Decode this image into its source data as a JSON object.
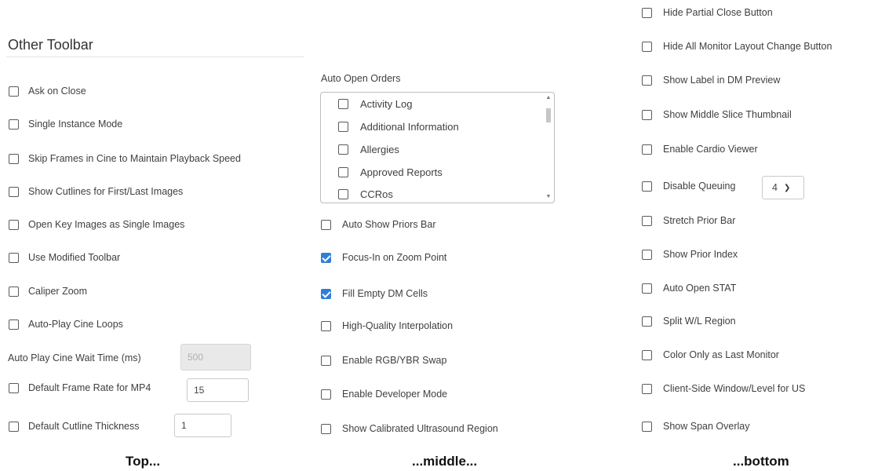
{
  "left": {
    "title": "Other Toolbar",
    "checkboxes": [
      {
        "label": "Ask on Close",
        "checked": false
      },
      {
        "label": "Single Instance Mode",
        "checked": false
      },
      {
        "label": "Skip Frames in Cine to Maintain Playback Speed",
        "checked": false
      },
      {
        "label": "Show Cutlines for First/Last Images",
        "checked": false
      },
      {
        "label": "Open Key Images as Single Images",
        "checked": false
      },
      {
        "label": "Use Modified Toolbar",
        "checked": false
      },
      {
        "label": "Caliper Zoom",
        "checked": false
      },
      {
        "label": "Auto-Play Cine Loops",
        "checked": false
      }
    ],
    "wait_time": {
      "label": "Auto Play Cine Wait Time (ms)",
      "value": "500"
    },
    "frame_rate": {
      "label": "Default Frame Rate for MP4",
      "value": "15",
      "checked": false
    },
    "cutline": {
      "label": "Default Cutline Thickness",
      "value": "1",
      "checked": false
    }
  },
  "middle": {
    "list_label": "Auto Open Orders",
    "list_items": [
      {
        "label": "Activity Log",
        "checked": false
      },
      {
        "label": "Additional Information",
        "checked": false
      },
      {
        "label": "Allergies",
        "checked": false
      },
      {
        "label": "Approved Reports",
        "checked": false
      },
      {
        "label": "CCRos",
        "checked": false
      }
    ],
    "checkboxes": [
      {
        "label": "Auto Show Priors Bar",
        "checked": false
      },
      {
        "label": "Focus-In on Zoom Point",
        "checked": true
      },
      {
        "label": "Fill Empty DM Cells",
        "checked": true
      },
      {
        "label": "High-Quality Interpolation",
        "checked": false
      },
      {
        "label": "Enable RGB/YBR Swap",
        "checked": false
      },
      {
        "label": "Enable Developer Mode",
        "checked": false
      },
      {
        "label": "Show Calibrated Ultrasound Region",
        "checked": false
      }
    ]
  },
  "right": {
    "checkboxes": [
      {
        "label": "Hide Partial Close Button",
        "checked": false
      },
      {
        "label": "Hide All Monitor Layout Change Button",
        "checked": false
      },
      {
        "label": "Show Label in DM Preview",
        "checked": false
      },
      {
        "label": "Show Middle Slice Thumbnail",
        "checked": false
      },
      {
        "label": "Enable Cardio Viewer",
        "checked": false
      },
      {
        "label": "Disable Queuing",
        "checked": false
      },
      {
        "label": "Stretch Prior Bar",
        "checked": false
      },
      {
        "label": "Show Prior Index",
        "checked": false
      },
      {
        "label": "Auto Open STAT",
        "checked": false
      },
      {
        "label": "Split W/L Region",
        "checked": false
      },
      {
        "label": "Color Only as Last Monitor",
        "checked": false
      },
      {
        "label": "Client-Side Window/Level for US",
        "checked": false
      },
      {
        "label": "Show Span Overlay",
        "checked": false
      }
    ],
    "queue_select": {
      "value": "4"
    }
  },
  "captions": {
    "top": "Top...",
    "middle": "...middle...",
    "bottom": "...bottom"
  },
  "colors": {
    "accent": "#2f7fd6"
  }
}
